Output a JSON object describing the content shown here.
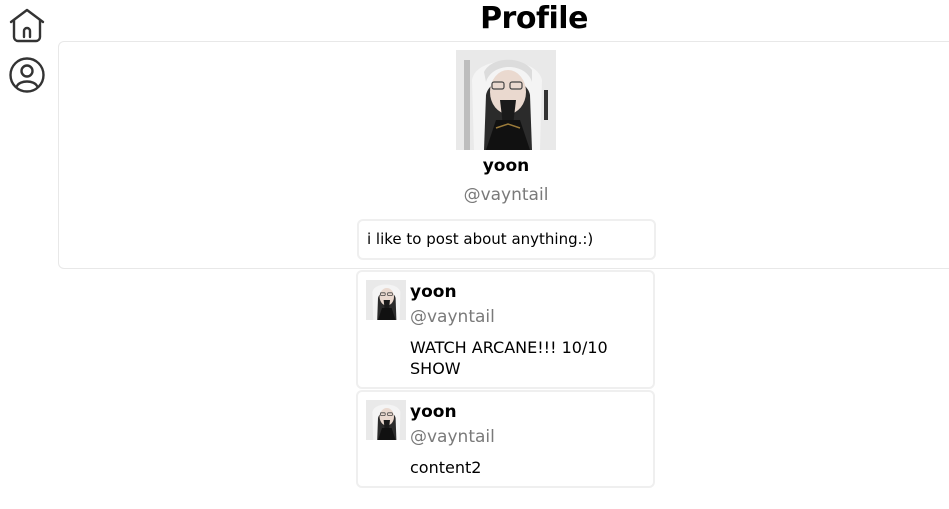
{
  "page": {
    "title": "Profile"
  },
  "nav": [
    {
      "icon": "home-icon",
      "label": "Home"
    },
    {
      "icon": "user-circle-icon",
      "label": "Profile"
    }
  ],
  "profile": {
    "display_name": "yoon",
    "handle": "@vayntail",
    "bio": "i like to post about anything.:)",
    "avatar": "avatar-image"
  },
  "posts": [
    {
      "display_name": "yoon",
      "handle": "@vayntail",
      "content": "WATCH ARCANE!!! 10/10 SHOW"
    },
    {
      "display_name": "yoon",
      "handle": "@vayntail",
      "content": "content2"
    }
  ],
  "colors": {
    "border": "#efefef",
    "muted_text": "#7a7a7a",
    "text": "#000000"
  }
}
